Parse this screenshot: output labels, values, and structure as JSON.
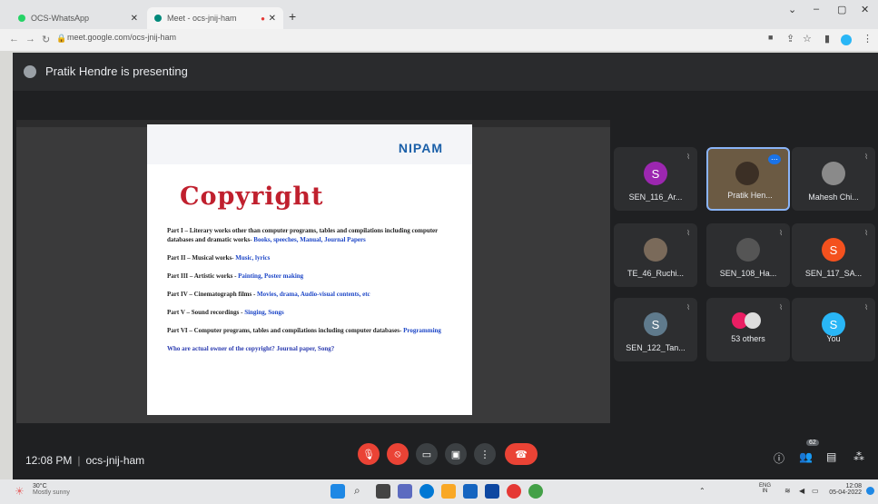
{
  "browser": {
    "tabs": [
      {
        "label": "OCS-WhatsApp"
      },
      {
        "label": "Meet - ocs-jnij-ham"
      }
    ],
    "url": "meet.google.com/ocs-jnij-ham",
    "new_tab": "+"
  },
  "meet": {
    "presenter_text": "Pratik Hendre is presenting",
    "time": "12:08 PM",
    "meeting_code": "ocs-jnij-ham",
    "participant_count": "62"
  },
  "slide": {
    "logo": "NIPAM",
    "title": "Copyright",
    "items": [
      {
        "label": "Part I – Literary works other than computer programs, tables and compilations including computer databases and dramatic works-",
        "examples": " Books, speeches, Manual, Journal Papers"
      },
      {
        "label": "Part II – Musical works-",
        "examples": " Music, lyrics"
      },
      {
        "label": "Part III – Artistic works -",
        "examples": " Painting, Poster making"
      },
      {
        "label": "Part IV – Cinematograph films -",
        "examples": " Movies, drama, Audio-visual contents, etc"
      },
      {
        "label": "Part V – Sound recordings -",
        "examples": " Singing, Songs"
      },
      {
        "label": "Part VI – Computer programs, tables and compilations including computer databases-",
        "examples": " Programming"
      }
    ],
    "question": "Who are actual owner of the copyright? Journal paper, Song?"
  },
  "participants": [
    {
      "name": "SEN_116_Ar...",
      "initial": "S",
      "color": "#9c27b0"
    },
    {
      "name": "Pratik Hen...",
      "initial": "",
      "color": "#6b5a43"
    },
    {
      "name": "Mahesh Chi...",
      "initial": "",
      "color": "#8a8a8a"
    },
    {
      "name": "TE_46_Ruchi...",
      "initial": "",
      "color": "#7a6a5a"
    },
    {
      "name": "SEN_108_Ha...",
      "initial": "",
      "color": "#555555"
    },
    {
      "name": "SEN_117_SA...",
      "initial": "S",
      "color": "#f4511e"
    },
    {
      "name": "SEN_122_Tan...",
      "initial": "S",
      "color": "#5f7a8c"
    },
    {
      "name": "53 others",
      "initial": "",
      "color": "#e91e63"
    },
    {
      "name": "You",
      "initial": "S",
      "color": "#29b6f6"
    }
  ],
  "taskbar": {
    "weather_temp": "30°C",
    "weather_desc": "Mostly sunny",
    "lang": "ENG",
    "region": "IN",
    "clock_time": "12:08",
    "clock_date": "05-04-2022"
  }
}
